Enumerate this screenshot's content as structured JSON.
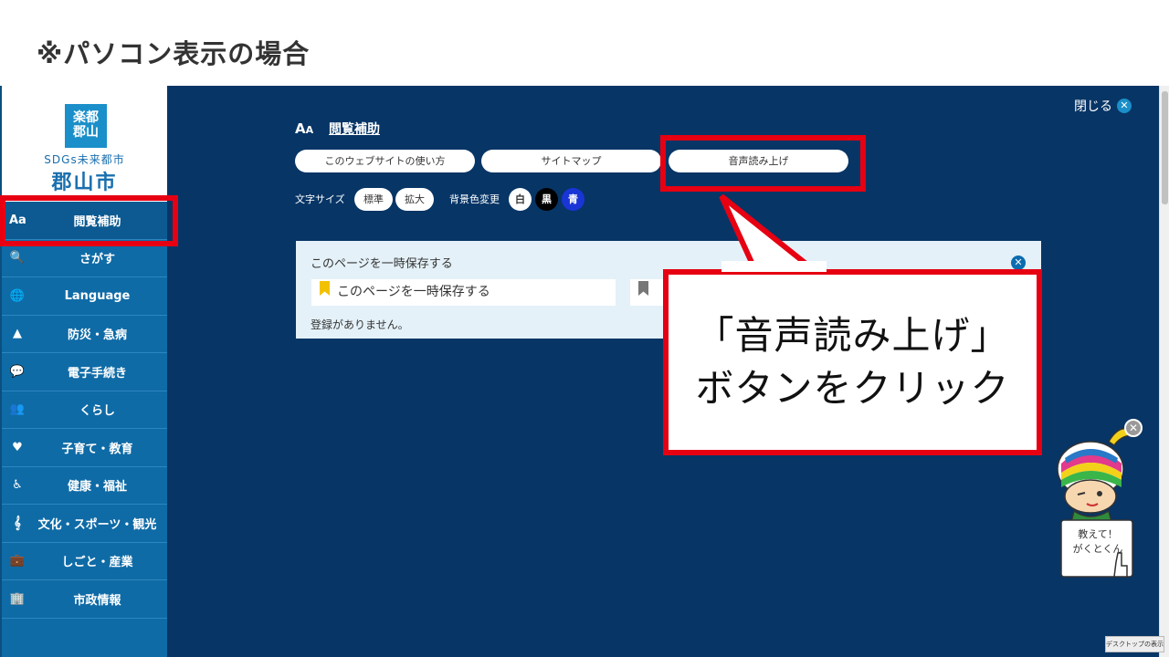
{
  "slide": {
    "title": "※パソコン表示の場合"
  },
  "logo": {
    "emblem": "楽都郡山",
    "sdgs": "SDGs未来都市",
    "city": "郡山市"
  },
  "sidebar": {
    "items": [
      {
        "icon": "font-size-icon",
        "glyph": "Aa",
        "label": "閲覧補助"
      },
      {
        "icon": "search-icon",
        "glyph": "🔍",
        "label": "さがす"
      },
      {
        "icon": "globe-icon",
        "glyph": "🌐",
        "label": "Language"
      },
      {
        "icon": "warning-icon",
        "glyph": "▲",
        "label": "防災・急病"
      },
      {
        "icon": "chat-icon",
        "glyph": "💬",
        "label": "電子手続き"
      },
      {
        "icon": "people-icon",
        "glyph": "👥",
        "label": "くらし"
      },
      {
        "icon": "heart-icon",
        "glyph": "♥",
        "label": "子育て・教育"
      },
      {
        "icon": "wheelchair-icon",
        "glyph": "♿",
        "label": "健康・福祉"
      },
      {
        "icon": "treble-clef-icon",
        "glyph": "𝄞",
        "label": "文化・スポーツ・観光"
      },
      {
        "icon": "briefcase-icon",
        "glyph": "💼",
        "label": "しごと・産業"
      },
      {
        "icon": "building-icon",
        "glyph": "🏢",
        "label": "市政情報"
      }
    ]
  },
  "panel": {
    "close_label": "閉じる",
    "heading": "閲覧補助",
    "buttons": [
      "このウェブサイトの使い方",
      "サイトマップ",
      "音声読み上げ"
    ],
    "font_size_label": "文字サイズ",
    "font_size_options": [
      "標準",
      "拡大"
    ],
    "bg_color_label": "背景色変更",
    "bg_color_options": [
      {
        "label": "白",
        "bg": "#ffffff",
        "fg": "#333333"
      },
      {
        "label": "黒",
        "bg": "#000000",
        "fg": "#ffffff"
      },
      {
        "label": "青",
        "bg": "#1a35d6",
        "fg": "#ffffff"
      }
    ]
  },
  "save_box": {
    "title": "このページを一時保存する",
    "save_button": "このページを一時保存する",
    "empty_message": "登録がありません。"
  },
  "callout": {
    "line1": "「音声読み上げ」",
    "line2": "ボタンをクリック"
  },
  "mascot": {
    "line1": "教えて！",
    "line2": "がくとくん"
  },
  "desktop_button": "デスクトップの表示",
  "colors": {
    "panel_bg": "#073566",
    "sidebar_bg": "#0f6ba6",
    "highlight_red": "#e60012"
  }
}
